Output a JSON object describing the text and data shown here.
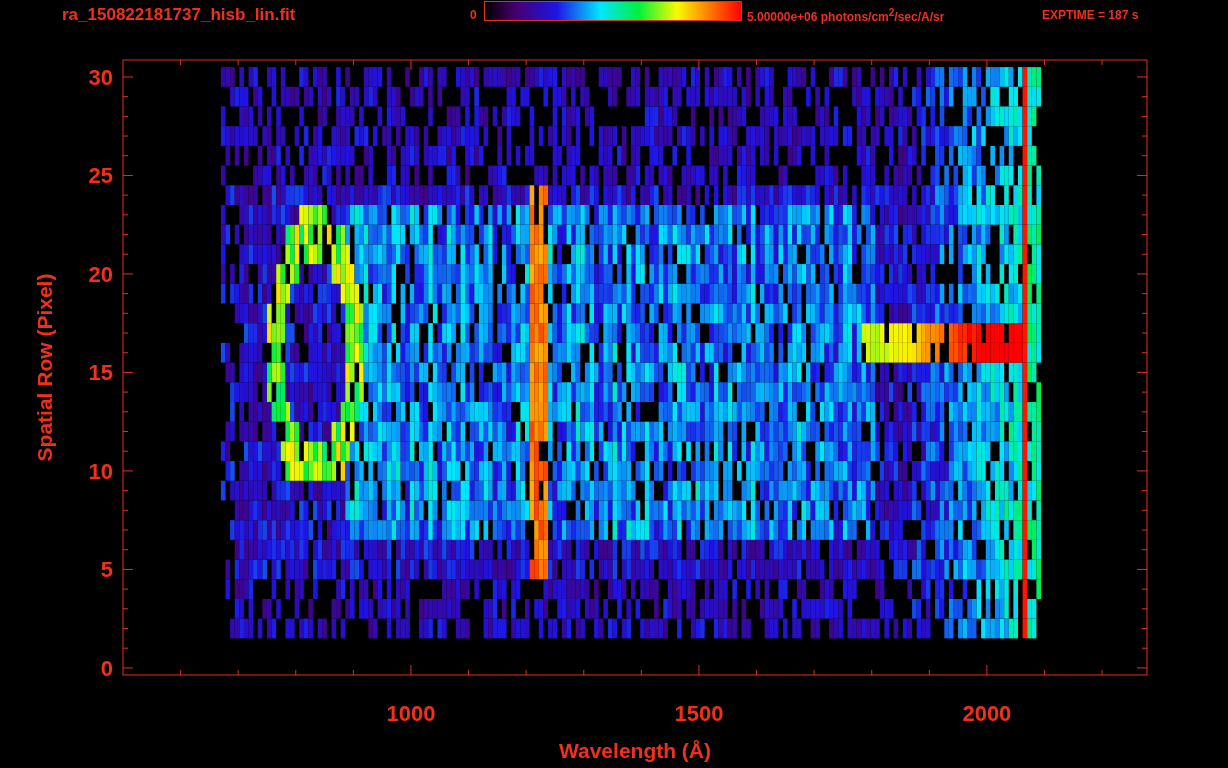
{
  "header": {
    "filename": "ra_150822181737_hisb_lin.fit",
    "colorbar_min": "0",
    "colorbar_max": "5.00000e+06 photons/cm$^{2}$/sec/A/sr",
    "exptime": "EXPTIME = 187 s"
  },
  "plot": {
    "xlabel": "Wavelength (Å)",
    "ylabel": "Spatial Row (Pixel)",
    "xticks": [
      "1000",
      "1500",
      "2000"
    ],
    "yticks": [
      "30",
      "25",
      "20",
      "15",
      "10",
      "5",
      "0"
    ]
  }
}
